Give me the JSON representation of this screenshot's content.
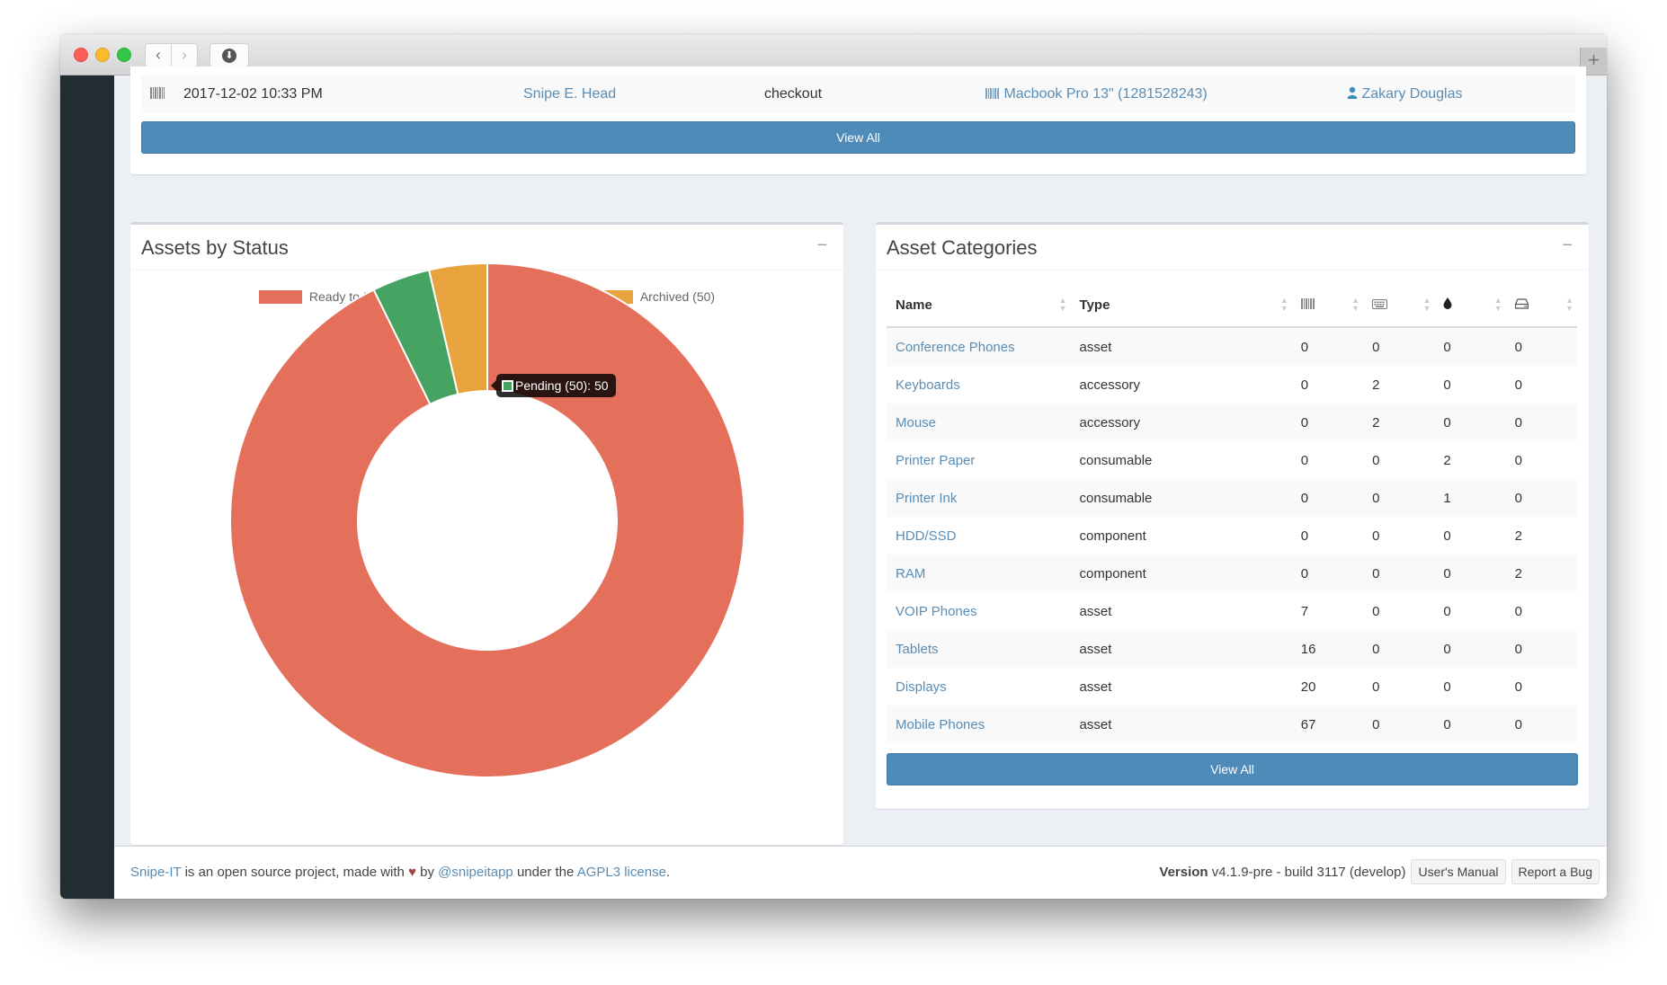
{
  "browser": {
    "back_icon": "‹",
    "forward_icon": "›",
    "download_icon": "⬇",
    "new_tab_icon": "+"
  },
  "activity": {
    "row": {
      "icon": "barcode-icon",
      "date": "2017-12-02 10:33 PM",
      "admin": "Snipe E. Head",
      "action": "checkout",
      "item": "Macbook Pro 13\" (1281528243)",
      "target": "Zakary Douglas"
    },
    "view_all": "View All"
  },
  "status_box": {
    "title": "Assets by Status",
    "collapse": "−"
  },
  "categories_box": {
    "title": "Asset Categories",
    "collapse": "−",
    "columns": {
      "name": "Name",
      "type": "Type",
      "assets_icon": "barcode-icon",
      "accessories_icon": "keyboard-icon",
      "consumables_icon": "tint-icon",
      "components_icon": "hdd-icon"
    },
    "rows": [
      {
        "name": "Conference Phones",
        "type": "asset",
        "assets": "0",
        "accessories": "0",
        "consumables": "0",
        "components": "0"
      },
      {
        "name": "Keyboards",
        "type": "accessory",
        "assets": "0",
        "accessories": "2",
        "consumables": "0",
        "components": "0"
      },
      {
        "name": "Mouse",
        "type": "accessory",
        "assets": "0",
        "accessories": "2",
        "consumables": "0",
        "components": "0"
      },
      {
        "name": "Printer Paper",
        "type": "consumable",
        "assets": "0",
        "accessories": "0",
        "consumables": "2",
        "components": "0"
      },
      {
        "name": "Printer Ink",
        "type": "consumable",
        "assets": "0",
        "accessories": "0",
        "consumables": "1",
        "components": "0"
      },
      {
        "name": "HDD/SSD",
        "type": "component",
        "assets": "0",
        "accessories": "0",
        "consumables": "0",
        "components": "2"
      },
      {
        "name": "RAM",
        "type": "component",
        "assets": "0",
        "accessories": "0",
        "consumables": "0",
        "components": "2"
      },
      {
        "name": "VOIP Phones",
        "type": "asset",
        "assets": "7",
        "accessories": "0",
        "consumables": "0",
        "components": "0"
      },
      {
        "name": "Tablets",
        "type": "asset",
        "assets": "16",
        "accessories": "0",
        "consumables": "0",
        "components": "0"
      },
      {
        "name": "Displays",
        "type": "asset",
        "assets": "20",
        "accessories": "0",
        "consumables": "0",
        "components": "0"
      },
      {
        "name": "Mobile Phones",
        "type": "asset",
        "assets": "67",
        "accessories": "0",
        "consumables": "0",
        "components": "0"
      }
    ],
    "view_all": "View All"
  },
  "chart_data": {
    "type": "pie",
    "variant": "doughnut",
    "title": "Assets by Status",
    "legend_position": "top",
    "categories": [
      "Ready to Deploy (1,273)",
      "Pending (50)",
      "Archived (50)"
    ],
    "values": [
      1273,
      50,
      50
    ],
    "colors": [
      "#e4705c",
      "#47a362",
      "#e8a23e"
    ],
    "tooltip": {
      "label": "Pending (50): 50",
      "series_index": 1
    }
  },
  "footer": {
    "brand": "Snipe-IT",
    "text1": " is an open source project, made with ",
    "heart": "♥",
    "text2": " by ",
    "handle": "@snipeitapp",
    "text3": " under the ",
    "license": "AGPL3 license",
    "text4": ".",
    "version_label": "Version",
    "version_value": "v4.1.9-pre - build 3117 (develop)",
    "manual_button": "User's Manual",
    "bug_button": "Report a Bug"
  },
  "colors": {
    "primary": "#4f8bb9",
    "link": "#3c8dbc",
    "sidebar": "#222d32",
    "content_bg": "#ecf0f5"
  }
}
